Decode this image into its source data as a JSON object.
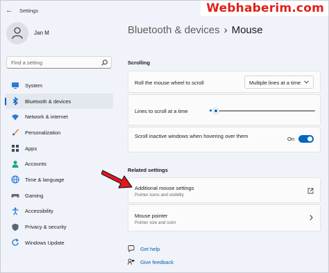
{
  "window": {
    "app_title": "Settings",
    "back_glyph": "←",
    "watermark": "Webhaberim.com"
  },
  "profile": {
    "name": "Jan M"
  },
  "search": {
    "placeholder": "Find a setting"
  },
  "sidebar": {
    "items": [
      {
        "label": "System",
        "icon": "monitor-icon",
        "active": false
      },
      {
        "label": "Bluetooth & devices",
        "icon": "bluetooth-icon",
        "active": true
      },
      {
        "label": "Network & internet",
        "icon": "wifi-icon",
        "active": false
      },
      {
        "label": "Personalization",
        "icon": "brush-icon",
        "active": false
      },
      {
        "label": "Apps",
        "icon": "apps-icon",
        "active": false
      },
      {
        "label": "Accounts",
        "icon": "person-icon",
        "active": false
      },
      {
        "label": "Time & language",
        "icon": "globe-icon",
        "active": false
      },
      {
        "label": "Gaming",
        "icon": "controller-icon",
        "active": false
      },
      {
        "label": "Accessibility",
        "icon": "accessibility-icon",
        "active": false
      },
      {
        "label": "Privacy & security",
        "icon": "shield-icon",
        "active": false
      },
      {
        "label": "Windows Update",
        "icon": "update-icon",
        "active": false
      }
    ]
  },
  "breadcrumb": {
    "parent": "Bluetooth & devices",
    "separator": "›",
    "current": "Mouse"
  },
  "scrolling": {
    "title": "Scrolling",
    "roll_wheel_label": "Roll the mouse wheel to scroll",
    "roll_wheel_value": "Multiple lines at a time",
    "lines_label": "Lines to scroll at a time",
    "lines_slider_fraction": 0.03,
    "inactive_label": "Scroll inactive windows when hovering over them",
    "inactive_state": "On"
  },
  "related": {
    "title": "Related settings",
    "additional_title": "Additional mouse settings",
    "additional_sub": "Pointer icons and visibility",
    "pointer_title": "Mouse pointer",
    "pointer_sub": "Pointer size and color"
  },
  "help": {
    "get_help": "Get help",
    "give_feedback": "Give feedback"
  },
  "colors": {
    "accent": "#0067c0",
    "annotation_arrow": "#e8161b"
  }
}
